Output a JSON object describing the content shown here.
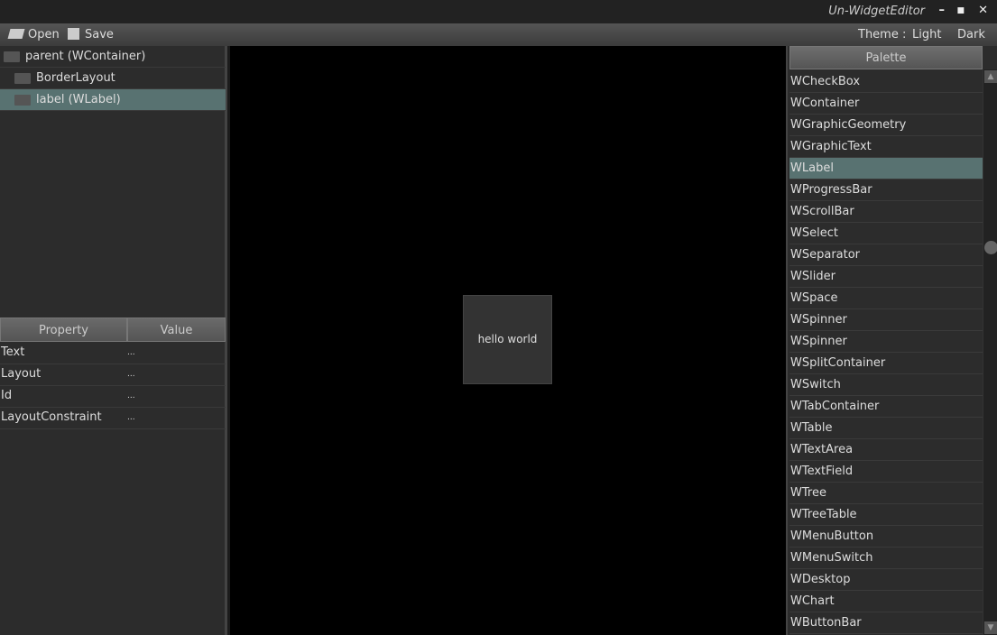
{
  "window": {
    "title": "Un-WidgetEditor",
    "minimize": "–",
    "maximize": "■",
    "close": "✕"
  },
  "toolbar": {
    "open": "Open",
    "save": "Save",
    "theme_label": "Theme :",
    "light": "Light",
    "dark": "Dark"
  },
  "tree": [
    {
      "label": "parent (WContainer)",
      "selected": false
    },
    {
      "label": "BorderLayout",
      "selected": false
    },
    {
      "label": "label (WLabel)",
      "selected": true
    }
  ],
  "properties": {
    "headers": [
      "Property",
      "Value"
    ],
    "rows": [
      {
        "name": "Text",
        "value": "..."
      },
      {
        "name": "Layout",
        "value": "..."
      },
      {
        "name": "Id",
        "value": "..."
      },
      {
        "name": "LayoutConstraint",
        "value": "..."
      }
    ]
  },
  "canvas": {
    "label_text": "hello world"
  },
  "palette": {
    "header": "Palette",
    "selected": "WLabel",
    "items": [
      "WCheckBox",
      "WContainer",
      "WGraphicGeometry",
      "WGraphicText",
      "WLabel",
      "WProgressBar",
      "WScrollBar",
      "WSelect",
      "WSeparator",
      "WSlider",
      "WSpace",
      "WSpinner",
      "WSpinner",
      "WSplitContainer",
      "WSwitch",
      "WTabContainer",
      "WTable",
      "WTextArea",
      "WTextField",
      "WTree",
      "WTreeTable",
      "WMenuButton",
      "WMenuSwitch",
      "WDesktop",
      "WChart",
      "WButtonBar"
    ],
    "scroll_position": 0.3
  },
  "colors": {
    "selection": "#587271"
  }
}
